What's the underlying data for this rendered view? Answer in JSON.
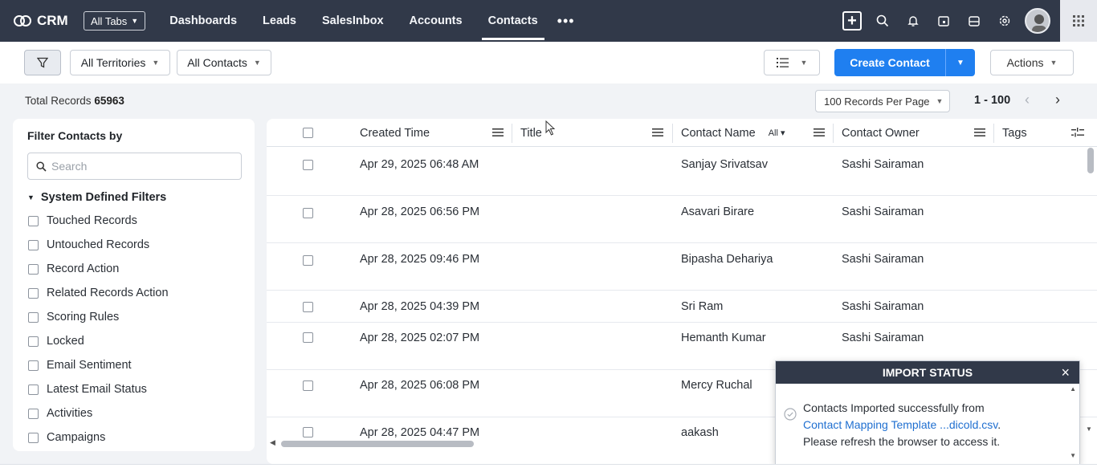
{
  "nav": {
    "brand": "CRM",
    "all_tabs": "All Tabs",
    "tabs": [
      {
        "label": "Dashboards"
      },
      {
        "label": "Leads"
      },
      {
        "label": "SalesInbox"
      },
      {
        "label": "Accounts"
      },
      {
        "label": "Contacts",
        "active": true
      }
    ],
    "more": "•••",
    "icons": [
      "plus-icon",
      "search-icon",
      "bell-icon",
      "calendar-icon",
      "inbox-icon",
      "settings-icon",
      "avatar",
      "apps-grid-icon"
    ]
  },
  "toolbar": {
    "territory": "All Territories",
    "view": "All Contacts",
    "create_label": "Create Contact",
    "actions_label": "Actions"
  },
  "records": {
    "total_label": "Total Records",
    "total_value": "65963",
    "per_page": "100 Records Per Page",
    "range": "1 - 100"
  },
  "filters": {
    "title": "Filter Contacts by",
    "search_placeholder": "Search",
    "group_label": "System Defined Filters",
    "items": [
      "Touched Records",
      "Untouched Records",
      "Record Action",
      "Related Records Action",
      "Scoring Rules",
      "Locked",
      "Email Sentiment",
      "Latest Email Status",
      "Activities",
      "Campaigns"
    ]
  },
  "table": {
    "columns": {
      "created_time": "Created Time",
      "title": "Title",
      "contact_name": "Contact Name",
      "contact_name_filter": "All",
      "contact_owner": "Contact Owner",
      "tags": "Tags"
    },
    "rows": [
      {
        "created": "Apr 29, 2025 06:48 AM",
        "title": "",
        "name": "Sanjay Srivatsav",
        "owner": "Sashi Sairaman"
      },
      {
        "created": "Apr 28, 2025 06:56 PM",
        "title": "",
        "name": "Asavari Birare",
        "owner": "Sashi Sairaman"
      },
      {
        "created": "Apr 28, 2025 09:46 PM",
        "title": "",
        "name": "Bipasha Dehariya",
        "owner": "Sashi Sairaman"
      },
      {
        "created": "Apr 28, 2025 04:39 PM",
        "title": "",
        "name": "Sri Ram",
        "owner": "Sashi Sairaman"
      },
      {
        "created": "Apr 28, 2025 02:07 PM",
        "title": "",
        "name": "Hemanth Kumar",
        "owner": "Sashi Sairaman"
      },
      {
        "created": "Apr 28, 2025 06:08 PM",
        "title": "",
        "name": "Mercy Ruchal",
        "owner": ""
      },
      {
        "created": "Apr 28, 2025 04:47 PM",
        "title": "",
        "name": "aakash",
        "owner": ""
      }
    ]
  },
  "import_popup": {
    "title": "IMPORT STATUS",
    "close": "×",
    "line1": "Contacts Imported successfully from",
    "link": "Contact Mapping Template ...dicold.csv",
    "link_suffix": ".",
    "line3": "Please refresh the browser to access it."
  }
}
